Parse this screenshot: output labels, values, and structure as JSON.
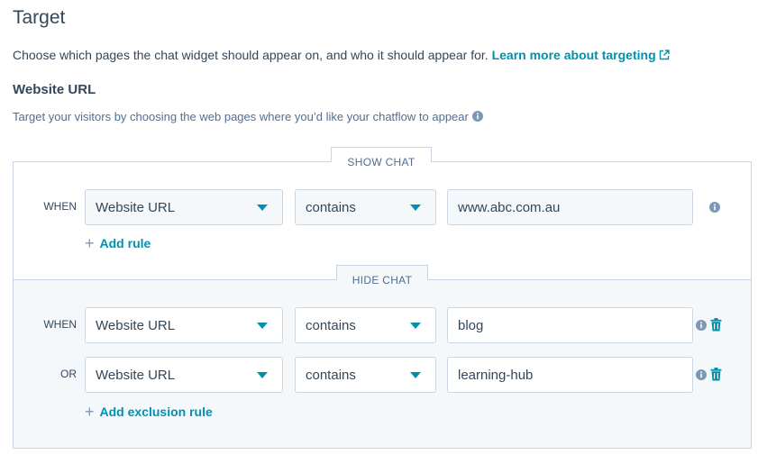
{
  "header": {
    "title": "Target",
    "description": "Choose which pages the chat widget should appear on, and who it should appear for.",
    "learn_more": "Learn more about targeting"
  },
  "website_url": {
    "title": "Website URL",
    "description": "Target your visitors by choosing the web pages where you’d like your chatflow to appear"
  },
  "show_chat": {
    "tab_label": "SHOW CHAT",
    "rules": [
      {
        "condition": "WHEN",
        "field": "Website URL",
        "operator": "contains",
        "value": "www.abc.com.au"
      }
    ],
    "add_label": "Add rule"
  },
  "hide_chat": {
    "tab_label": "HIDE CHAT",
    "rules": [
      {
        "condition": "WHEN",
        "field": "Website URL",
        "operator": "contains",
        "value": "blog"
      },
      {
        "condition": "OR",
        "field": "Website URL",
        "operator": "contains",
        "value": "learning-hub"
      }
    ],
    "add_label": "Add exclusion rule"
  },
  "colors": {
    "text": "#33475b",
    "link": "#0091ae",
    "border": "#cbd6e2",
    "panel_bg": "#f5f8fa"
  },
  "icons": [
    "external-link-icon",
    "info-icon",
    "caret-down-icon",
    "plus-icon",
    "trash-icon"
  ]
}
